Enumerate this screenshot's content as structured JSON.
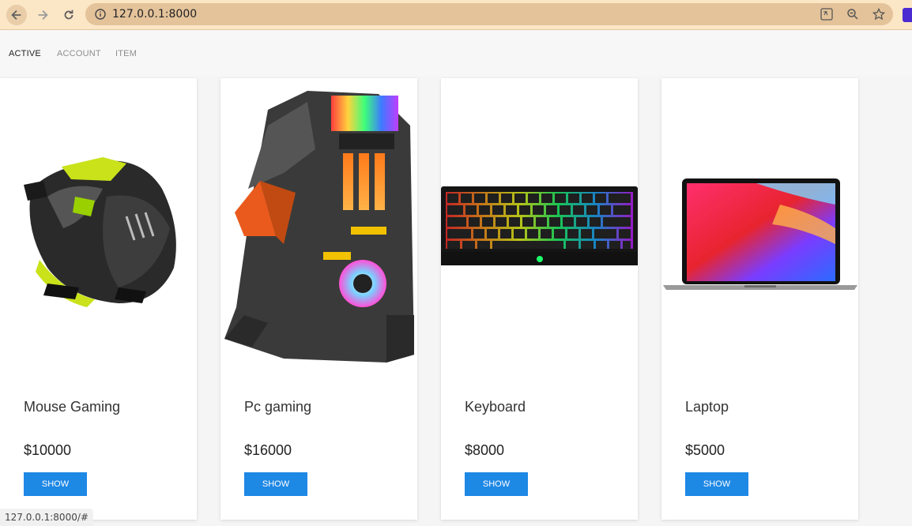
{
  "browser": {
    "url": "127.0.0.1:8000",
    "accent": "#e4c39a"
  },
  "nav": {
    "items": [
      {
        "label": "ACTIVE",
        "active": true
      },
      {
        "label": "ACCOUNT",
        "active": false
      },
      {
        "label": "ITEM",
        "active": false
      }
    ]
  },
  "products": [
    {
      "name": "Mouse Gaming",
      "price": "$10000",
      "button": "SHOW",
      "image": "gaming-mouse"
    },
    {
      "name": "Pc gaming",
      "price": "$16000",
      "button": "SHOW",
      "image": "gaming-pc-case"
    },
    {
      "name": "Keyboard",
      "price": "$8000",
      "button": "SHOW",
      "image": "rgb-keyboard"
    },
    {
      "name": "Laptop",
      "price": "$5000",
      "button": "SHOW",
      "image": "laptop"
    }
  ],
  "status_bar": {
    "text": "127.0.0.1:8000/#"
  },
  "colors": {
    "button": "#1e88e5",
    "nav_active": "#222222",
    "nav_inactive": "#8e8e8e"
  }
}
